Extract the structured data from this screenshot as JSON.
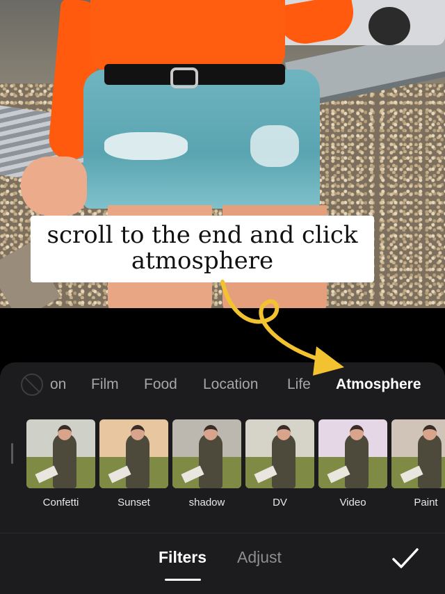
{
  "caption": {
    "line1": "scroll to the end and click",
    "line2": "atmosphere"
  },
  "category_tabs": {
    "items": [
      {
        "label": "on",
        "active": false
      },
      {
        "label": "Film",
        "active": false
      },
      {
        "label": "Food",
        "active": false
      },
      {
        "label": "Location",
        "active": false
      },
      {
        "label": "Life",
        "active": false
      },
      {
        "label": "Atmosphere",
        "active": true
      }
    ],
    "none_icon": "no-filter-icon"
  },
  "filters": [
    {
      "label": "Confetti",
      "tint": "#cfd0c8"
    },
    {
      "label": "Sunset",
      "tint": "#e8c6a0"
    },
    {
      "label": "shadow",
      "tint": "#bcb8b0"
    },
    {
      "label": "DV",
      "tint": "#d6d3c8"
    },
    {
      "label": "Video",
      "tint": "#e6d7e6"
    },
    {
      "label": "Paint",
      "tint": "#d0c4b8"
    }
  ],
  "bottom_bar": {
    "tabs": [
      {
        "label": "Filters",
        "active": true
      },
      {
        "label": "Adjust",
        "active": false
      }
    ],
    "confirm_icon": "checkmark-icon"
  },
  "colors": {
    "panel": "#1c1c1e",
    "arrow": "#f2c230",
    "active_text": "#ffffff",
    "inactive_text": "#a6a6a8"
  }
}
